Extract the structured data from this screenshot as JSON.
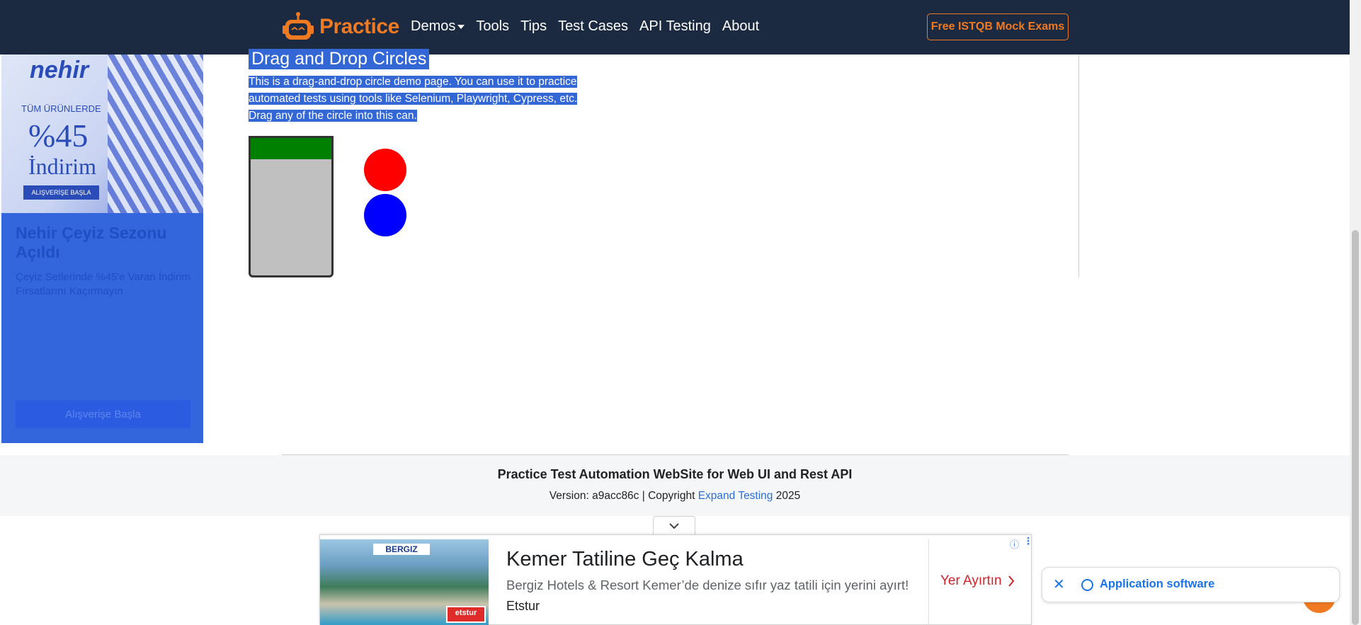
{
  "navbar": {
    "brand": "Practice",
    "links": [
      "Demos",
      "Tools",
      "Tips",
      "Test Cases",
      "API Testing",
      "About"
    ],
    "cta": "Free ISTQB Mock Exams"
  },
  "left_ad": {
    "brand": "nehir",
    "line1": "TÜM ÜRÜNLERDE",
    "percent": "%45",
    "discount": "İndirim",
    "mini_button": "ALIŞVERİŞE BAŞLA",
    "title": "Nehir Çeyiz Sezonu Açıldı",
    "description": "Çeyiz Setlerinde %45'e Varan İndirim Fırsatlarını Kaçırmayın",
    "cta": "Alışverişe Başla"
  },
  "main": {
    "title": "Drag and Drop Circles",
    "intro_lines": [
      "This is a drag-and-drop circle demo page. You can use it to practice",
      "automated tests using tools like Selenium, Playwright, Cypress, etc.",
      "Drag any of the circle into this can."
    ],
    "circles": [
      {
        "color": "#ff0000",
        "name": "red"
      },
      {
        "color": "#0000ff",
        "name": "blue"
      }
    ],
    "can_lid_color": "#008000",
    "can_body_color": "#c0c0c0"
  },
  "footer": {
    "title": "Practice Test Automation WebSite for Web UI and Rest API",
    "version_prefix": "Version: a9acc86c | Copyright",
    "link": "Expand Testing",
    "year": "2025"
  },
  "bottom_ad": {
    "image_logo": "BERGIZ",
    "image_badge": "etstur",
    "title": "Kemer Tatiline Geç Kalma",
    "description": "Bergiz Hotels & Resort Kemer’de denize sıfır yaz tatili için yerini ayırt!",
    "advertiser": "Etstur",
    "cta": "Yer Ayırtın"
  },
  "chip": {
    "label": "Application software"
  },
  "colors": {
    "navbar": "#1b2a41",
    "accent": "#f07a22",
    "selection": "#3367d6"
  }
}
